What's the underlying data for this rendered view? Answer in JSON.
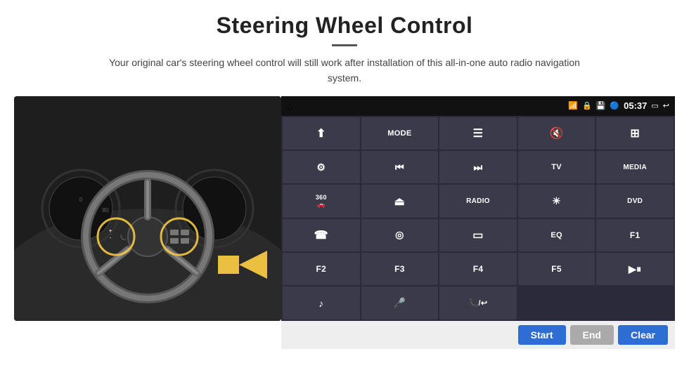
{
  "title": "Steering Wheel Control",
  "divider": true,
  "subtitle": "Your original car's steering wheel control will still work after installation of this all-in-one auto radio navigation system.",
  "status_bar": {
    "left_icon": "home",
    "wifi_icon": "wifi",
    "lock_icon": "lock",
    "sd_icon": "sd",
    "bt_icon": "bluetooth",
    "time": "05:37",
    "cast_icon": "cast",
    "back_icon": "back"
  },
  "grid_buttons": [
    {
      "label": "↑",
      "type": "icon",
      "row": 1
    },
    {
      "label": "MODE",
      "type": "text"
    },
    {
      "label": "≡",
      "type": "icon"
    },
    {
      "label": "🔇",
      "type": "icon"
    },
    {
      "label": "⊞",
      "type": "icon"
    },
    {
      "label": "⚙",
      "type": "icon"
    },
    {
      "label": "⏮",
      "type": "icon"
    },
    {
      "label": "⏭",
      "type": "icon"
    },
    {
      "label": "TV",
      "type": "text"
    },
    {
      "label": "MEDIA",
      "type": "text"
    },
    {
      "label": "360",
      "type": "text-small"
    },
    {
      "label": "▲",
      "type": "icon"
    },
    {
      "label": "RADIO",
      "type": "text"
    },
    {
      "label": "☀",
      "type": "icon"
    },
    {
      "label": "DVD",
      "type": "text"
    },
    {
      "label": "☎",
      "type": "icon"
    },
    {
      "label": "◎",
      "type": "icon"
    },
    {
      "label": "▭",
      "type": "icon"
    },
    {
      "label": "EQ",
      "type": "text"
    },
    {
      "label": "F1",
      "type": "text"
    },
    {
      "label": "F2",
      "type": "text"
    },
    {
      "label": "F3",
      "type": "text"
    },
    {
      "label": "F4",
      "type": "text"
    },
    {
      "label": "F5",
      "type": "text"
    },
    {
      "label": "▶⏸",
      "type": "icon"
    },
    {
      "label": "♪",
      "type": "icon"
    },
    {
      "label": "🎤",
      "type": "icon"
    },
    {
      "label": "📞",
      "type": "icon"
    },
    {
      "label": "",
      "type": "empty"
    },
    {
      "label": "",
      "type": "empty"
    }
  ],
  "action_buttons": {
    "start": "Start",
    "end": "End",
    "clear": "Clear"
  }
}
